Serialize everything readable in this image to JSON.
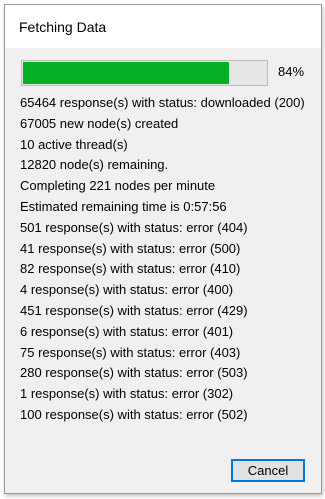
{
  "dialog": {
    "title": "Fetching Data"
  },
  "progress": {
    "fraction": 0.84,
    "label": "84%",
    "fill_color": "#06b025"
  },
  "status_lines": [
    "65464 response(s) with status: downloaded (200)",
    "67005 new node(s) created",
    "10 active thread(s)",
    "12820 node(s) remaining.",
    "Completing 221 nodes per minute",
    "Estimated remaining time is 0:57:56",
    "501 response(s) with status: error (404)",
    "41 response(s) with status: error (500)",
    "82 response(s) with status: error (410)",
    "4 response(s) with status: error (400)",
    "451 response(s) with status: error (429)",
    "6 response(s) with status: error (401)",
    "75 response(s) with status: error (403)",
    "280 response(s) with status: error (503)",
    "1 response(s) with status: error (302)",
    "100 response(s) with status: error (502)"
  ],
  "buttons": {
    "cancel_label": "Cancel"
  }
}
